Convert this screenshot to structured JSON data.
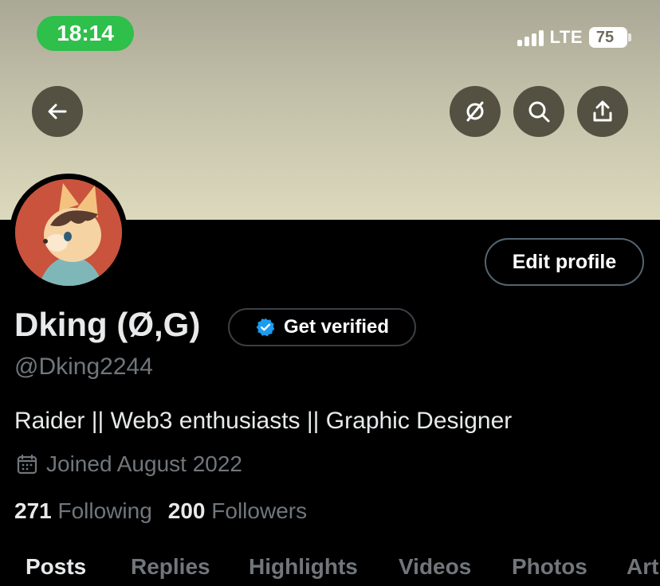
{
  "status_bar": {
    "time": "18:14",
    "network": "LTE",
    "battery": "75"
  },
  "profile": {
    "display_name": "Dking (Ø,G)",
    "handle": "@Dking2244",
    "bio": "Raider || Web3 enthusiasts || Graphic Designer",
    "joined": "Joined August 2022",
    "following_count": "271",
    "following_label": "Following",
    "followers_count": "200",
    "followers_label": "Followers"
  },
  "buttons": {
    "edit_profile": "Edit profile",
    "get_verified": "Get verified"
  },
  "tabs": [
    "Posts",
    "Replies",
    "Highlights",
    "Videos",
    "Photos",
    "Art"
  ],
  "colors": {
    "verified_blue": "#1d9bf0",
    "time_pill": "#2fbf4b",
    "muted_text": "#71767b"
  },
  "icons": [
    "back-arrow-icon",
    "grok-icon",
    "search-icon",
    "share-icon",
    "verified-badge-icon",
    "calendar-icon"
  ]
}
